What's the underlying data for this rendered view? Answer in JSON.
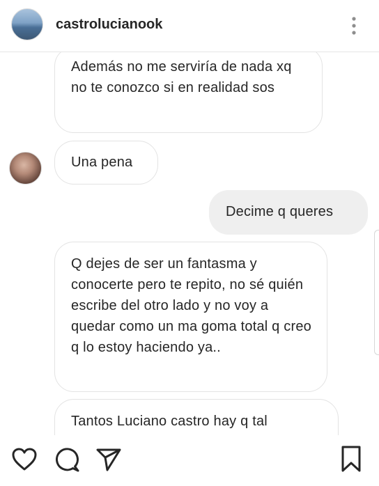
{
  "header": {
    "username": "castrolucianook"
  },
  "messages": [
    {
      "direction": "incoming",
      "text": "Además no me serviría de nada xq no te conozco si en realidad sos"
    },
    {
      "direction": "incoming",
      "text": "Una pena"
    },
    {
      "direction": "outgoing",
      "text": "Decime q queres"
    },
    {
      "direction": "incoming",
      "text": "Q dejes de ser un fantasma y conocerte pero te repito, no sé quién escribe del otro lado y no voy a quedar como un ma goma total q creo q lo estoy haciendo ya.."
    },
    {
      "direction": "incoming",
      "text": "Tantos Luciano castro hay q tal"
    }
  ],
  "actions": {
    "like": "heart-icon",
    "comment": "comment-icon",
    "share": "paper-plane-icon",
    "save": "bookmark-icon"
  }
}
